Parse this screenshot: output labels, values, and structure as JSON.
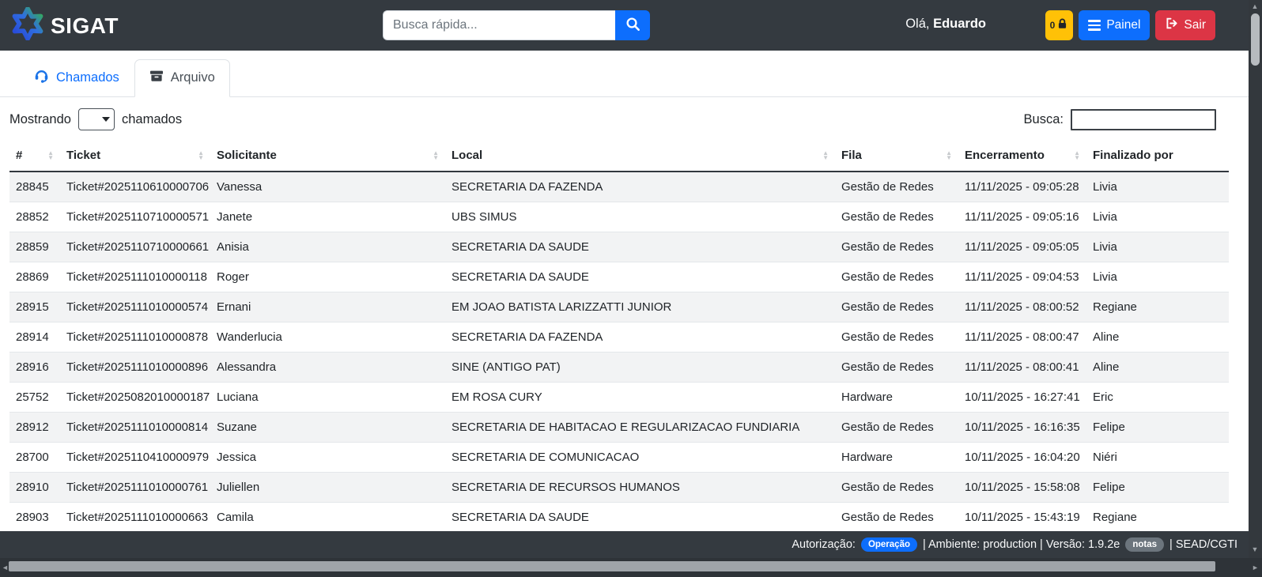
{
  "header": {
    "brand": "SIGAT",
    "search_placeholder": "Busca rápida...",
    "greeting_prefix": "Olá, ",
    "greeting_name": "Eduardo",
    "lock_count": "0",
    "painel_label": "Painel",
    "sair_label": "Sair"
  },
  "tabs": {
    "chamados_label": "Chamados",
    "arquivo_label": "Arquivo",
    "active_tab": "Arquivo"
  },
  "controls": {
    "mostrando_prefix": "Mostrando",
    "mostrando_suffix": "chamados",
    "select_value": "",
    "busca_label": "Busca:",
    "busca_value": ""
  },
  "table": {
    "columns": [
      "#",
      "Ticket",
      "Solicitante",
      "Local",
      "Fila",
      "Encerramento",
      "Finalizado por"
    ],
    "rows": [
      [
        "28845",
        "Ticket#2025110610000706",
        "Vanessa",
        "SECRETARIA DA FAZENDA",
        "Gestão de Redes",
        "11/11/2025 - 09:05:28",
        "Livia"
      ],
      [
        "28852",
        "Ticket#2025110710000571",
        "Janete",
        "UBS SIMUS",
        "Gestão de Redes",
        "11/11/2025 - 09:05:16",
        "Livia"
      ],
      [
        "28859",
        "Ticket#2025110710000661",
        "Anisia",
        "SECRETARIA DA SAUDE",
        "Gestão de Redes",
        "11/11/2025 - 09:05:05",
        "Livia"
      ],
      [
        "28869",
        "Ticket#2025111010000118",
        "Roger",
        "SECRETARIA DA SAUDE",
        "Gestão de Redes",
        "11/11/2025 - 09:04:53",
        "Livia"
      ],
      [
        "28915",
        "Ticket#2025111010000574",
        "Ernani",
        "EM JOAO BATISTA LARIZZATTI JUNIOR",
        "Gestão de Redes",
        "11/11/2025 - 08:00:52",
        "Regiane"
      ],
      [
        "28914",
        "Ticket#2025111010000878",
        "Wanderlucia",
        "SECRETARIA DA FAZENDA",
        "Gestão de Redes",
        "11/11/2025 - 08:00:47",
        "Aline"
      ],
      [
        "28916",
        "Ticket#2025111010000896",
        "Alessandra",
        "SINE (ANTIGO PAT)",
        "Gestão de Redes",
        "11/11/2025 - 08:00:41",
        "Aline"
      ],
      [
        "25752",
        "Ticket#2025082010000187",
        "Luciana",
        "EM ROSA CURY",
        "Hardware",
        "10/11/2025 - 16:27:41",
        "Eric"
      ],
      [
        "28912",
        "Ticket#2025111010000814",
        "Suzane",
        "SECRETARIA DE HABITACAO E REGULARIZACAO FUNDIARIA",
        "Gestão de Redes",
        "10/11/2025 - 16:16:35",
        "Felipe"
      ],
      [
        "28700",
        "Ticket#2025110410000979",
        "Jessica",
        "SECRETARIA DE COMUNICACAO",
        "Hardware",
        "10/11/2025 - 16:04:20",
        "Niéri"
      ],
      [
        "28910",
        "Ticket#2025111010000761",
        "Juliellen",
        "SECRETARIA DE RECURSOS HUMANOS",
        "Gestão de Redes",
        "10/11/2025 - 15:58:08",
        "Felipe"
      ],
      [
        "28903",
        "Ticket#2025111010000663",
        "Camila",
        "SECRETARIA DA SAUDE",
        "Gestão de Redes",
        "10/11/2025 - 15:43:19",
        "Regiane"
      ]
    ]
  },
  "footer": {
    "autorizacao_label": "Autorização:",
    "operacao_badge": "Operação",
    "ambiente_versao": "| Ambiente: production | Versão: 1.9.2e",
    "notas_badge": "notas",
    "orgao": "| SEAD/CGTI"
  },
  "colors": {
    "header_bg": "#343a40",
    "primary": "#0d6efd",
    "warning": "#ffc107",
    "danger": "#dc3545",
    "link": "#0d6efd",
    "stripe": "#f2f3f4"
  }
}
